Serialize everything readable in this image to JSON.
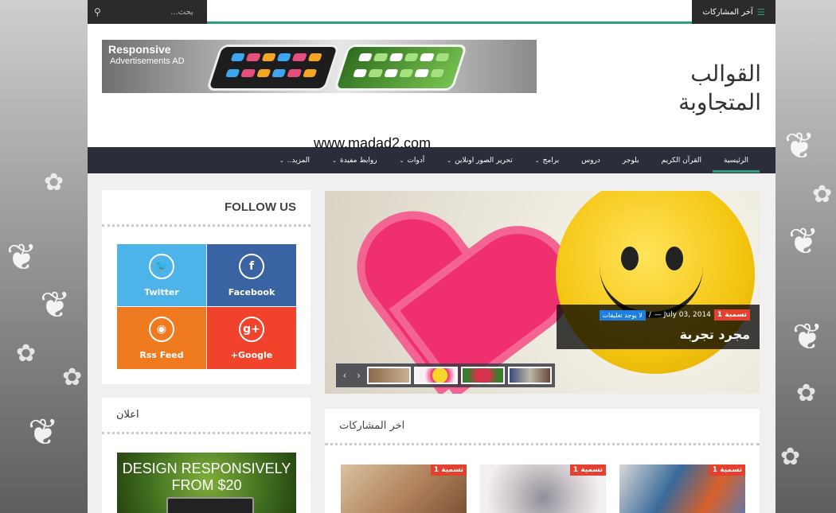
{
  "topbar": {
    "search_placeholder": "بحث...",
    "recent_tab_label": "آخر المشاركات"
  },
  "header": {
    "ad_line1": "Responsive",
    "ad_line2": "Advertisements AD",
    "site_title": "القوالب المتجاوبة",
    "site_url": "www.madad2.com"
  },
  "nav": {
    "items": [
      {
        "label": "الرئيسية",
        "dropdown": false
      },
      {
        "label": "القرآن الكريم",
        "dropdown": false
      },
      {
        "label": "بلوجر",
        "dropdown": false
      },
      {
        "label": "دروس",
        "dropdown": false
      },
      {
        "label": "برامج",
        "dropdown": true
      },
      {
        "label": "تحرير الصور اونلاين",
        "dropdown": true
      },
      {
        "label": "أدوات",
        "dropdown": true
      },
      {
        "label": "روابط مفيدة",
        "dropdown": true
      },
      {
        "label": "المزيد..",
        "dropdown": true
      }
    ]
  },
  "follow": {
    "title": "FOLLOW US",
    "twitter": "Twitter",
    "facebook": "Facebook",
    "rss": "Rss Feed",
    "google": "+Google"
  },
  "ad_widget": {
    "title": "اعلان",
    "line1": "DESIGN RESPONSIVELY",
    "line2": "FROM $20"
  },
  "slider": {
    "category": "تسمية 1",
    "date": "July 03, 2014 —",
    "separator": "/",
    "comments": "لا يوجد تعليقات",
    "title": "مجرد تجربة",
    "prev": "‹",
    "next": "›"
  },
  "recent": {
    "title": "اخر المشاركات",
    "tag": "تسمية 1"
  },
  "colors": {
    "accent": "#2e9e7d",
    "nav_bg": "#2b2d3a",
    "tag_red": "#e5402f",
    "tag_blue": "#1f7fe0"
  }
}
